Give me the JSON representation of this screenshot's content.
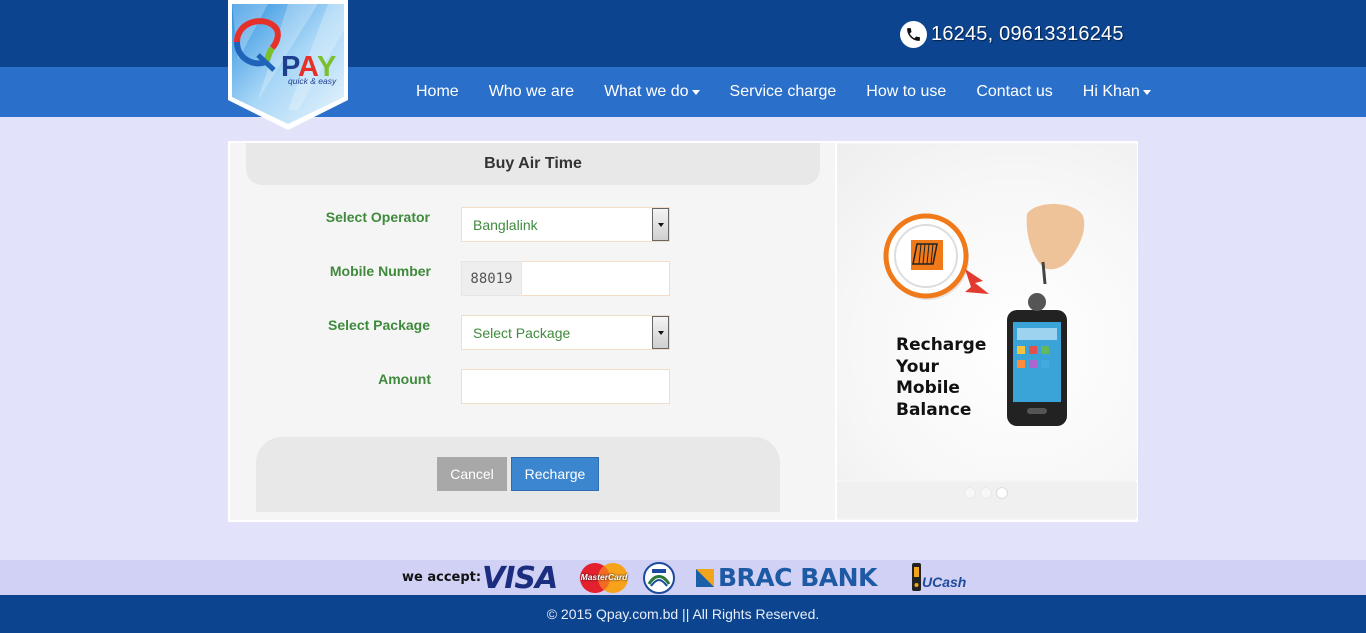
{
  "header": {
    "phone": "16245, 09613316245",
    "logo": {
      "brand": "PAY",
      "tagline": "quick & easy"
    }
  },
  "nav": [
    {
      "label": "Home",
      "dropdown": false
    },
    {
      "label": "Who we are",
      "dropdown": false
    },
    {
      "label": "What we do",
      "dropdown": true
    },
    {
      "label": "Service charge",
      "dropdown": false
    },
    {
      "label": "How to use",
      "dropdown": false
    },
    {
      "label": "Contact us",
      "dropdown": false
    },
    {
      "label": "Hi Khan",
      "dropdown": true
    }
  ],
  "form": {
    "title": "Buy Air Time",
    "operator_label": "Select Operator",
    "operator_value": "Banglalink",
    "mobile_label": "Mobile Number",
    "mobile_prefix": "88019",
    "mobile_value": "",
    "package_label": "Select Package",
    "package_value": "Select Package",
    "amount_label": "Amount",
    "amount_value": "",
    "cancel_label": "Cancel",
    "recharge_label": "Recharge"
  },
  "slider": {
    "lines": [
      "Recharge",
      "Your",
      "Mobile",
      "Balance"
    ],
    "operator_logo_text": "banglalink",
    "active_slide": 3,
    "slide_count": 3
  },
  "payments": {
    "label": "we accept:",
    "visa": "VISA",
    "mastercard": "MasterCard",
    "brac": "BRAC BANK",
    "ucash": "UCash"
  },
  "footer": {
    "copyright": "© 2015 Qpay.com.bd || All Rights Reserved."
  },
  "colors": {
    "header": "#0c4490",
    "navbar": "#2a6fc9",
    "background": "#e2e3fb",
    "label_green": "#3f8a3c",
    "recharge_button": "#3c86cf"
  }
}
